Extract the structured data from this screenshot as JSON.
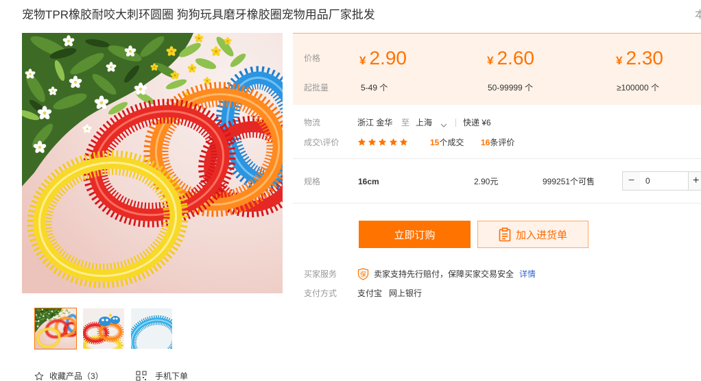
{
  "page": {
    "title": "宠物TPR橡胶耐咬大刺环圆圈 狗狗玩具磨牙橡胶圈宠物用品厂家批发",
    "corner_text": "本"
  },
  "colors": {
    "accent": "#ff7300",
    "price_bg": "#fff2e8",
    "link": "#3366cc",
    "text": "#333333",
    "muted": "#999999"
  },
  "gallery": {
    "selected_index": 0
  },
  "price": {
    "label": "价格",
    "moq_label": "起批量",
    "currency": "¥",
    "tiers": [
      {
        "price": "2.90",
        "quantity": "5-49 个"
      },
      {
        "price": "2.60",
        "quantity": "50-99999 个"
      },
      {
        "price": "2.30",
        "quantity": "≥100000 个"
      }
    ]
  },
  "shipping": {
    "label": "物流",
    "origin": "浙江 金华",
    "connector": "至",
    "destination": "上海",
    "method": "快递",
    "fee": "¥6"
  },
  "deals": {
    "label": "成交\\评价",
    "rating": 5,
    "deal_count": "15",
    "deal_suffix": "个成交",
    "review_count": "16",
    "review_suffix": "条评价"
  },
  "spec": {
    "label": "规格",
    "name": "16cm",
    "price": "2.90元",
    "stock": "999251个可售",
    "quantity": "0",
    "decrement": "−",
    "increment": "+"
  },
  "actions": {
    "buy_now": "立即订购",
    "add_to_cart": "加入进货单",
    "favorite": "收藏产品（3）",
    "mobile_order": "手机下单"
  },
  "service": {
    "label": "买家服务",
    "badge": "保",
    "text": "卖家支持先行赔付，保障买家交易安全",
    "details_link": "详情"
  },
  "payment": {
    "label": "支付方式",
    "methods": [
      "支付宝",
      "网上银行"
    ]
  }
}
